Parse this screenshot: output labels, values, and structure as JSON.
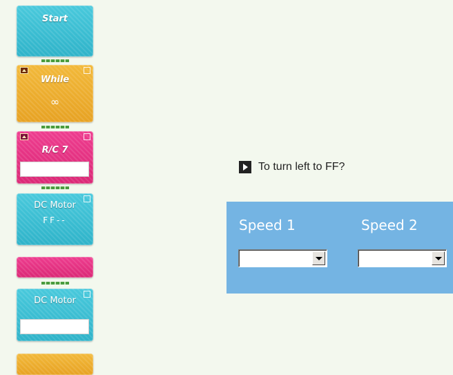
{
  "blocks": {
    "start": {
      "label": "Start"
    },
    "while": {
      "label": "While",
      "value": "∞"
    },
    "rc": {
      "label": "R/C 7"
    },
    "dc_motor_1": {
      "label": "DC Motor",
      "value": "FF--"
    },
    "dc_motor_2": {
      "label": "DC Motor"
    }
  },
  "hint": {
    "text": "To turn left to FF?"
  },
  "speed_panel": {
    "speed1_label": "Speed 1",
    "speed2_label": "Speed 2",
    "speed1_value": "",
    "speed2_value": ""
  },
  "colors": {
    "cyan_block": "#2fb3c9",
    "orange_block": "#e7a223",
    "pink_block": "#db2876",
    "panel_bg": "#74b4e3",
    "page_bg": "#f3f8ee"
  }
}
